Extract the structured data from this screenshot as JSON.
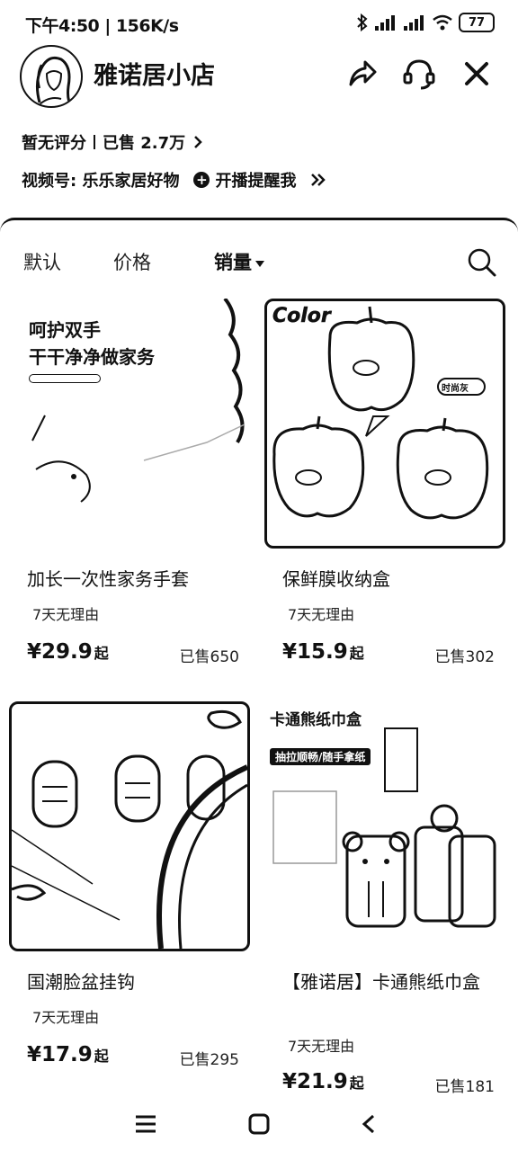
{
  "status_bar": {
    "text": "下午4:50 | 156K/s",
    "battery": "77"
  },
  "shop": {
    "name": "雅诺居小店",
    "rating": "暂无评分",
    "sold": "已售 2.7万",
    "channel": "视频号: 乐乐家居好物",
    "live_remind": "开播提醒我"
  },
  "sort": {
    "default": "默认",
    "price": "价格",
    "sales": "销量"
  },
  "products": [
    {
      "title": "加长一次性家务手套",
      "tag": "7天无理由",
      "price": "¥29.9",
      "price_suffix": "起",
      "sold": "已售650",
      "thumb_text_1": "呵护双手",
      "thumb_text_2": "干干净净做家务"
    },
    {
      "title": "保鲜膜收纳盒",
      "tag": "7天无理由",
      "price": "¥15.9",
      "price_suffix": "起",
      "sold": "已售302",
      "thumb_text_1": "Color",
      "thumb_text_2": "时尚灰"
    },
    {
      "title": "国潮脸盆挂钩",
      "tag": "7天无理由",
      "price": "¥17.9",
      "price_suffix": "起",
      "sold": "已售295"
    },
    {
      "title": "【雅诺居】卡通熊纸巾盒",
      "tag": "7天无理由",
      "price": "¥21.9",
      "price_suffix": "起",
      "sold": "已售181",
      "thumb_text_1": "卡通熊纸巾盒",
      "thumb_text_2": "抽拉顺畅/随手拿纸"
    }
  ],
  "icons": {
    "share": "share-icon",
    "service": "customer-service-icon",
    "close": "close-icon",
    "search": "search-icon",
    "menu": "menu-icon",
    "home": "home-icon",
    "back": "back-icon"
  }
}
